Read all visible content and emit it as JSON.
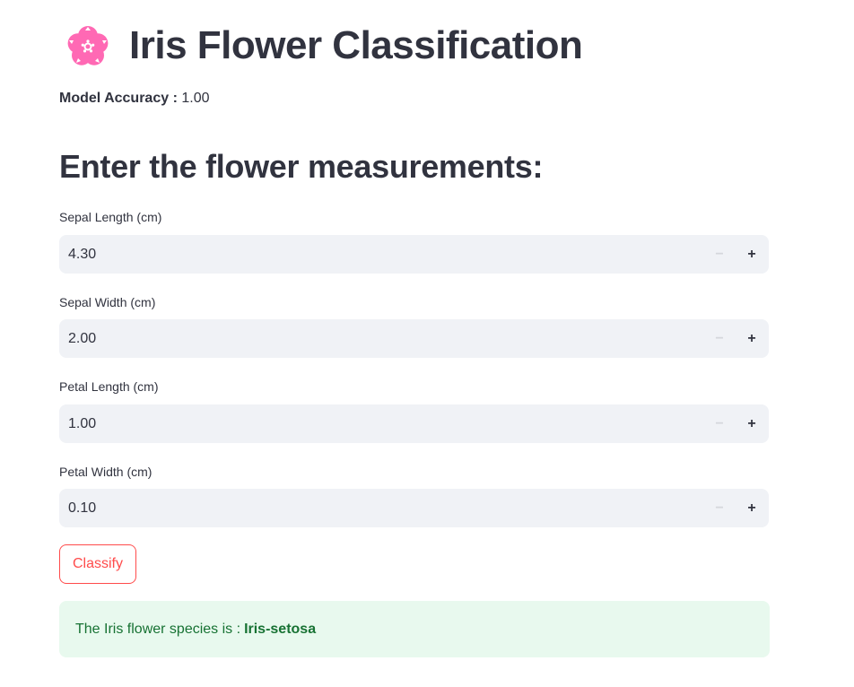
{
  "header": {
    "icon": "cherry-blossom-icon",
    "icon_color": "#ff69b4",
    "title": "Iris Flower Classification"
  },
  "accuracy": {
    "label": "Model Accuracy :",
    "value": "1.00"
  },
  "form": {
    "heading": "Enter the flower measurements:",
    "fields": [
      {
        "label": "Sepal Length (cm)",
        "value": "4.30"
      },
      {
        "label": "Sepal Width (cm)",
        "value": "2.00"
      },
      {
        "label": "Petal Length (cm)",
        "value": "1.00"
      },
      {
        "label": "Petal Width (cm)",
        "value": "0.10"
      }
    ],
    "minus_symbol": "−",
    "plus_symbol": "+",
    "classify_label": "Classify"
  },
  "result": {
    "prefix": "The Iris flower species is :",
    "species": "Iris-setosa",
    "bg_color": "#e8f9ee",
    "text_color": "#177233"
  },
  "colors": {
    "accent": "#ff4b4b",
    "field_bg": "#f0f2f6",
    "text": "#31333f"
  }
}
